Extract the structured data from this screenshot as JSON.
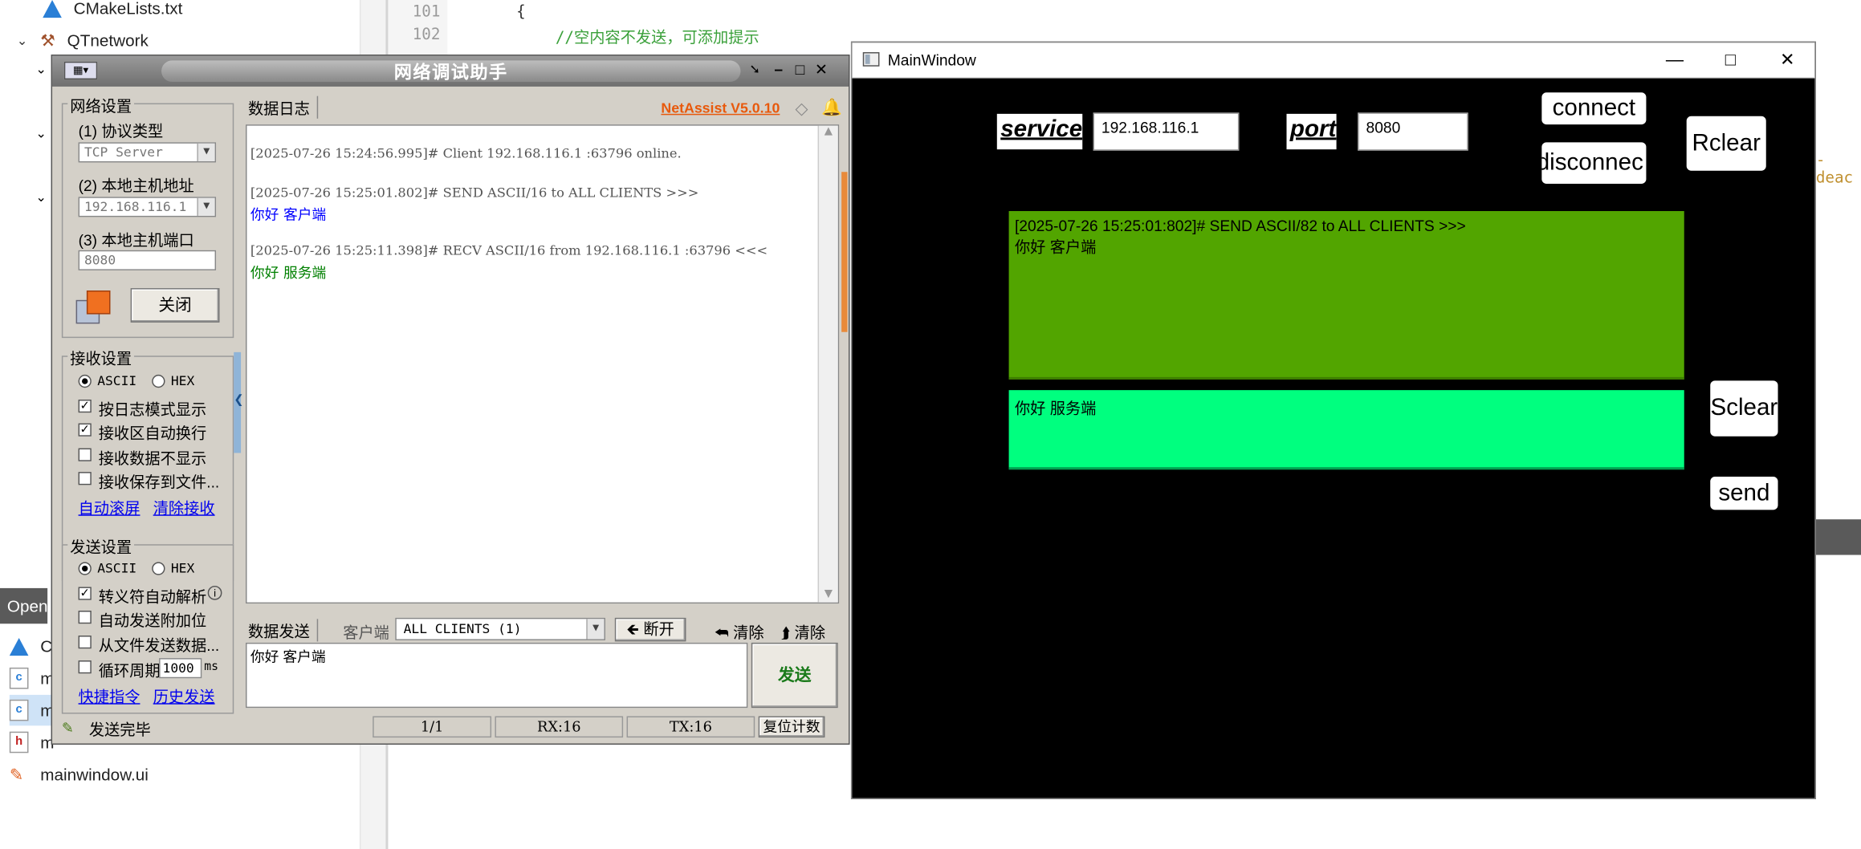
{
  "ide": {
    "tree": [
      {
        "label": "CMakeLists.txt"
      },
      {
        "label": "QTnetwork"
      }
    ],
    "line_numbers": [
      "101",
      "102"
    ],
    "code_brace": "{",
    "code_comment": "//空内容不发送，可添加提示",
    "open_label": "Open",
    "open_files": [
      {
        "label": "C"
      },
      {
        "label": "m"
      },
      {
        "label": "m"
      },
      {
        "label": "m"
      },
      {
        "label": "mainwindow.ui"
      }
    ],
    "right_snippet": "-deac",
    "colors": {
      "cmake_icon": "#2a7fd6",
      "comment": "#3aa03a"
    }
  },
  "netassist": {
    "title": "网络调试助手",
    "network_settings": {
      "title": "网络设置",
      "protocol_label": "(1) 协议类型",
      "protocol_value": "TCP Server",
      "host_label": "(2) 本地主机地址",
      "host_value": "192.168.116.1",
      "port_label": "(3) 本地主机端口",
      "port_value": "8080",
      "close_button": "关闭"
    },
    "receive_settings": {
      "title": "接收设置",
      "ascii": "ASCII",
      "hex": "HEX",
      "options": [
        {
          "label": "按日志模式显示",
          "checked": true
        },
        {
          "label": "接收区自动换行",
          "checked": true
        },
        {
          "label": "接收数据不显示",
          "checked": false
        },
        {
          "label": "接收保存到文件...",
          "checked": false
        }
      ],
      "link_auto_scroll": "自动滚屏",
      "link_clear_receive": "清除接收"
    },
    "send_settings": {
      "title": "发送设置",
      "ascii": "ASCII",
      "hex": "HEX",
      "options": [
        {
          "label": "转义符自动解析",
          "checked": true
        },
        {
          "label": "自动发送附加位",
          "checked": false
        },
        {
          "label": "从文件发送数据...",
          "checked": false
        }
      ],
      "cycle_label": "循环周期",
      "cycle_value": "1000",
      "cycle_unit": "ms",
      "link_shortcut": "快捷指令",
      "link_history": "历史发送"
    },
    "log_tab": "数据日志",
    "brand": "NetAssist V5.0.10",
    "log_lines": [
      {
        "text": "[2025-07-26 15:24:56.995]# Client 192.168.116.1 :63796 online.",
        "color": "#555555"
      },
      {
        "text": "[2025-07-26 15:25:01.802]# SEND ASCII/16 to ALL CLIENTS >>>",
        "color": "#555555"
      },
      {
        "text": "你好 客户端",
        "color": "#0000ff"
      },
      {
        "text": "[2025-07-26 15:25:11.398]# RECV ASCII/16 from 192.168.116.1 :63796 <<<",
        "color": "#555555"
      },
      {
        "text": "你好 服务端",
        "color": "#008000"
      }
    ],
    "send_tab": "数据发送",
    "client_label": "客户端",
    "client_select": "ALL CLIENTS (1)",
    "disconnect_button": "断开",
    "clear1": "清除",
    "clear2": "清除",
    "send_text": "你好 客户端",
    "send_button": "发送",
    "status_text": "发送完毕",
    "status_count": "1/1",
    "status_rx": "RX:16",
    "status_tx": "TX:16",
    "reset_button": "复位计数",
    "colors": {
      "brand": "#e8590c",
      "send_button": "#1a7a1a"
    }
  },
  "mainwindow": {
    "title": "MainWindow",
    "service_label": "service",
    "service_value": "192.168.116.1",
    "port_label": "port",
    "port_value": "8080",
    "connect_button": "connect",
    "disconnect_button": "disconnec",
    "rclear_button": "Rclear",
    "sclear_button": "Sclear",
    "send_button": "send",
    "receive_text": "[2025-07-26 15:25:01:802]# SEND ASCII/82 to ALL CLIENTS >>>\n你好 客户端",
    "send_text": "你好 服务端",
    "colors": {
      "receive_bg": "#52a500",
      "send_bg": "#00ff7f",
      "window_bg": "#000000"
    }
  }
}
